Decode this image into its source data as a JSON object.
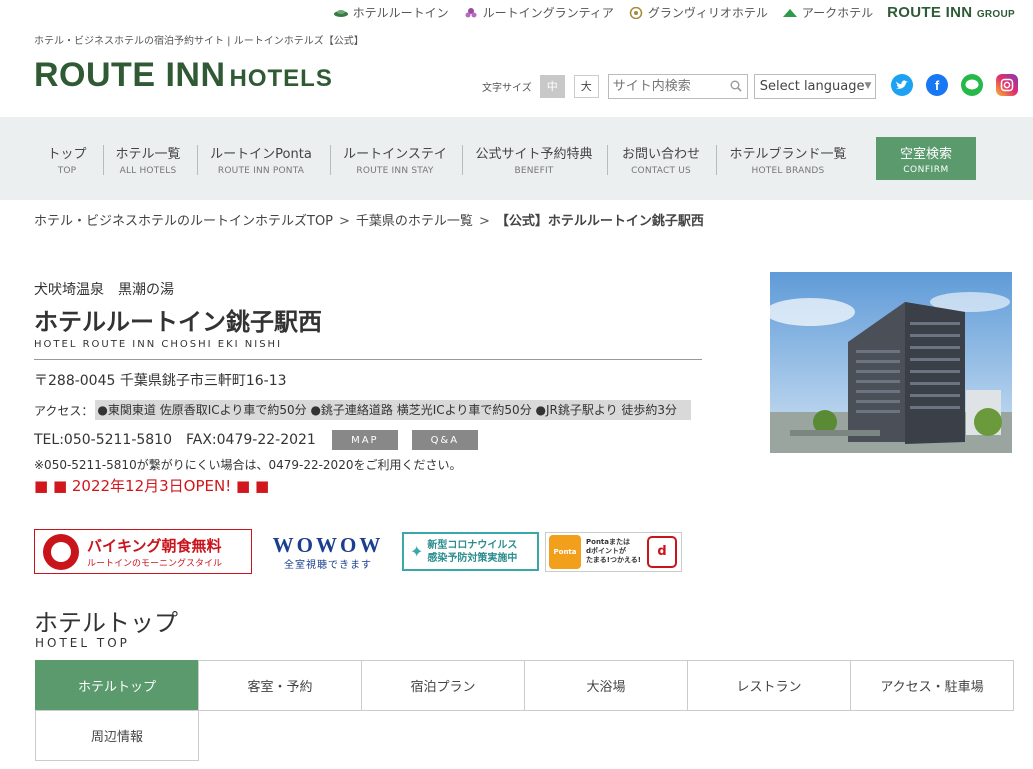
{
  "brands": [
    {
      "label": "ホテルルートイン",
      "icon": "route-inn-leaf-icon"
    },
    {
      "label": "ルートイングランティア",
      "icon": "grantia-flower-icon"
    },
    {
      "label": "グランヴィリオホテル",
      "icon": "granvilio-emblem-icon"
    },
    {
      "label": "アークホテル",
      "icon": "ark-hotel-leaf-icon"
    }
  ],
  "group_logo": {
    "main": "ROUTE INN",
    "sub": "GROUP"
  },
  "tagline": "ホテル・ビジネスホテルの宿泊予約サイト | ルートインホテルズ【公式】",
  "logo": {
    "main": "ROUTE INN",
    "sub": "HOTELS"
  },
  "font_size": {
    "label": "文字サイズ",
    "medium": "中",
    "large": "大"
  },
  "search": {
    "placeholder": "サイト内検索"
  },
  "language": {
    "selected": "Select language"
  },
  "social": [
    "twitter-icon",
    "facebook-icon",
    "line-icon",
    "instagram-icon"
  ],
  "nav": [
    {
      "jp": "トップ",
      "en": "TOP"
    },
    {
      "jp": "ホテル一覧",
      "en": "ALL HOTELS"
    },
    {
      "jp": "ルートインPonta",
      "en": "ROUTE INN PONTA"
    },
    {
      "jp": "ルートインステイ",
      "en": "ROUTE INN STAY"
    },
    {
      "jp": "公式サイト予約特典",
      "en": "BENEFIT"
    },
    {
      "jp": "お問い合わせ",
      "en": "CONTACT US"
    },
    {
      "jp": "ホテルブランド一覧",
      "en": "HOTEL BRANDS"
    }
  ],
  "confirm": {
    "jp": "空室検索",
    "en": "CONFIRM"
  },
  "breadcrumb": {
    "items": [
      "ホテル・ビジネスホテルのルートインホテルズTOP",
      "千葉県のホテル一覧",
      "【公式】ホテルルートイン銚子駅西"
    ],
    "separator": ">"
  },
  "hotel": {
    "onsen": "犬吠埼温泉　黒潮の湯",
    "name": "ホテルルートイン銚子駅西",
    "name_en": "HOTEL ROUTE INN CHOSHI EKI NISHI",
    "address": "〒288-0045 千葉県銚子市三軒町16-13",
    "access_label": "アクセス：",
    "access": "●東関東道 佐原香取ICより車で約50分 ●銚子連絡道路 横芝光ICより車で約50分 ●JR銚子駅より 徒歩約3分",
    "tel": "TEL:050-5211-5810",
    "fax": "FAX:0479-22-2021",
    "map_label": "MAP",
    "qa_label": "Q&A",
    "note": "※050-5211-5810が繋がりにくい場合は、0479-22-2020をご利用ください。",
    "open": "■ ■ 2022年12月3日OPEN! ■ ■"
  },
  "badges": {
    "buffet": {
      "title": "バイキング朝食無料",
      "sub": "ルートインのモーニングスタイル"
    },
    "wowow": {
      "title": "WOWOW",
      "sub": "全室視聴できます"
    },
    "covid": {
      "line1": "新型コロナウイルス",
      "line2": "感染予防対策実施中"
    },
    "ponta": {
      "logo": "Ponta",
      "line1": "Pontaまたは",
      "line2": "dポイントが",
      "line3": "たまる!つかえる!",
      "dpoint": "d"
    }
  },
  "section": {
    "title": "ホテルトップ",
    "sub": "HOTEL TOP"
  },
  "tabs": [
    "ホテルトップ",
    "客室・予約",
    "宿泊プラン",
    "大浴場",
    "レストラン",
    "アクセス・駐車場",
    "周辺情報"
  ],
  "colors": {
    "brand_green": "#2f5a33",
    "accent_green": "#5a9a6d",
    "open_red": "#d0171d"
  }
}
